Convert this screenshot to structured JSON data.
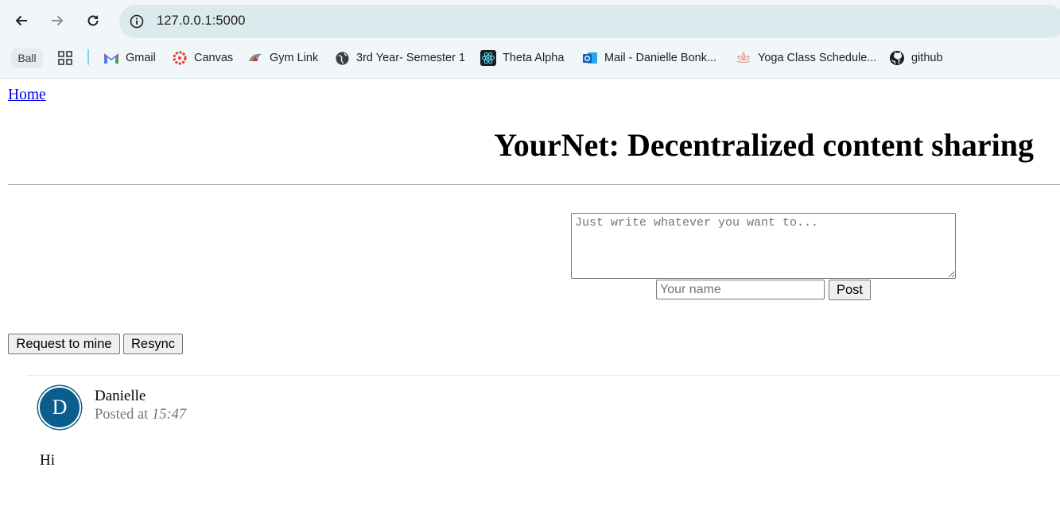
{
  "browser": {
    "url": "127.0.0.1:5000",
    "nav_icons": [
      "back-arrow-icon",
      "forward-arrow-icon",
      "reload-icon",
      "site-info-icon"
    ],
    "bookmarks": {
      "profile_chip": "Ball",
      "items": [
        {
          "label": "Gmail",
          "icon": "gmail-icon"
        },
        {
          "label": "Canvas",
          "icon": "canvas-icon"
        },
        {
          "label": "Gym Link",
          "icon": "gym-icon"
        },
        {
          "label": "3rd Year- Semester 1",
          "icon": "globe-icon"
        },
        {
          "label": "Theta Alpha",
          "icon": "react-icon"
        },
        {
          "label": "Mail - Danielle Bonk...",
          "icon": "outlook-icon"
        },
        {
          "label": "Yoga Class Schedule...",
          "icon": "yoga-icon"
        },
        {
          "label": "github",
          "icon": "github-icon"
        }
      ]
    }
  },
  "page": {
    "home_link": "Home",
    "title": "YourNet: Decentralized content sharing",
    "composer": {
      "content_placeholder": "Just write whatever you want to...",
      "name_placeholder": "Your name",
      "post_label": "Post"
    },
    "actions": {
      "mine_label": "Request to mine",
      "resync_label": "Resync"
    },
    "posts": [
      {
        "avatar_letter": "D",
        "author": "Danielle",
        "posted_prefix": "Posted at",
        "time": "15:47",
        "content": "Hi"
      }
    ]
  },
  "colors": {
    "link": "#0000ee",
    "avatar": "#0b5e8c",
    "chrome_bg": "#f1f7f8",
    "omnibox_bg": "#dbeaed"
  }
}
